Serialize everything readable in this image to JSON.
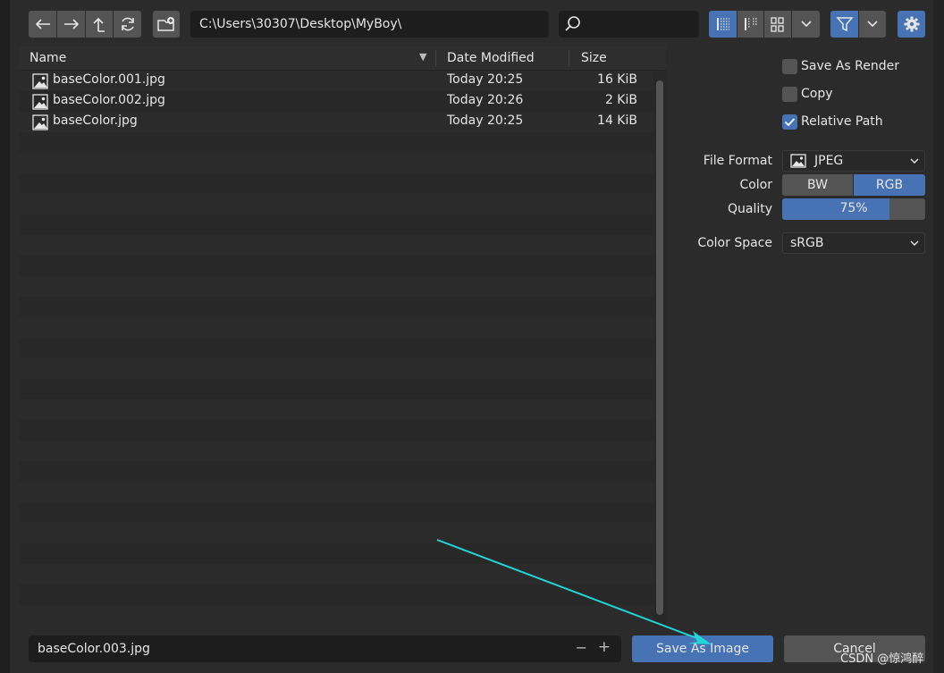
{
  "toolbar": {
    "path": "C:\\Users\\30307\\Desktop\\MyBoy\\",
    "search_placeholder": ""
  },
  "file_list": {
    "columns": {
      "name": "Name",
      "date": "Date Modified",
      "size": "Size"
    },
    "files": [
      {
        "name": "baseColor.001.jpg",
        "date": "Today 20:25",
        "size": "16 KiB"
      },
      {
        "name": "baseColor.002.jpg",
        "date": "Today 20:26",
        "size": "2 KiB"
      },
      {
        "name": "baseColor.jpg",
        "date": "Today 20:25",
        "size": "14 KiB"
      }
    ]
  },
  "options": {
    "save_as_render": {
      "label": "Save As Render",
      "checked": false
    },
    "copy": {
      "label": "Copy",
      "checked": false
    },
    "relative_path": {
      "label": "Relative Path",
      "checked": true
    },
    "file_format_label": "File Format",
    "file_format_value": "JPEG",
    "color_label": "Color",
    "color_options": [
      "BW",
      "RGB"
    ],
    "color_selected": "RGB",
    "quality_label": "Quality",
    "quality_value": "75%",
    "quality_fraction": 0.75,
    "color_space_label": "Color Space",
    "color_space_value": "sRGB"
  },
  "footer": {
    "filename": "baseColor.003.jpg",
    "minus": "−",
    "plus": "+",
    "save_label": "Save As Image",
    "cancel_label": "Cancel"
  },
  "watermark": "CSDN @惊鸿醉",
  "colors": {
    "accent": "#4772b3",
    "arrow": "#22d3d8"
  }
}
